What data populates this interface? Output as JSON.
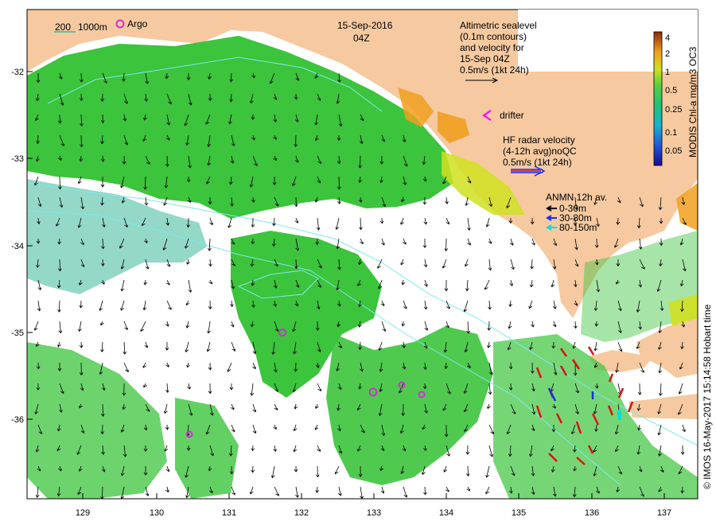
{
  "map": {
    "date_title": "15-Sep-2016",
    "time_title": "04Z",
    "lon_ticks": [
      "129",
      "130",
      "131",
      "132",
      "133",
      "134",
      "135",
      "136",
      "137"
    ],
    "lat_ticks": [
      "-32",
      "-33",
      "-34",
      "-35",
      "-36"
    ],
    "colors": {
      "land": "#f6c9a0",
      "ocean_nodata": "#ffffff",
      "chl_green": "#3cc43c",
      "chl_teal": "#3cb89a",
      "contour": "#7fe8e8",
      "argo": "#cc33cc",
      "drifter": "#ff00ff",
      "hf_radar": "#e01010",
      "anmn_0_30": "#000000",
      "anmn_30_80": "#1030ff",
      "anmn_80_150": "#00e0e0"
    }
  },
  "legend": {
    "isobath_left": "200",
    "isobath_right": "1000m",
    "argo_label": "Argo",
    "altimetry_lines": [
      "Altimetric sealevel",
      "(0.1m contours)",
      "and velocity for",
      "15-Sep 04Z",
      "0.5m/s (1kt 24h)"
    ],
    "drifter_label": "drifter",
    "hf_radar_lines": [
      "HF radar velocity",
      "(4-12h avg)noQC",
      "0.5m/s (1kt 24h)"
    ],
    "anmn_title": "ANMN 12h av.",
    "anmn_items": [
      "0-30m",
      "30-80m",
      "80-150m"
    ]
  },
  "colorbar": {
    "label": "MODIS Chl-a mg/m3 OC3",
    "ticks": [
      "4",
      "2",
      "1",
      "0.5",
      "0.25",
      "0.1",
      "0.05"
    ]
  },
  "credit": "© IMOS 16-May-2017 15:14:58 Hobart time"
}
